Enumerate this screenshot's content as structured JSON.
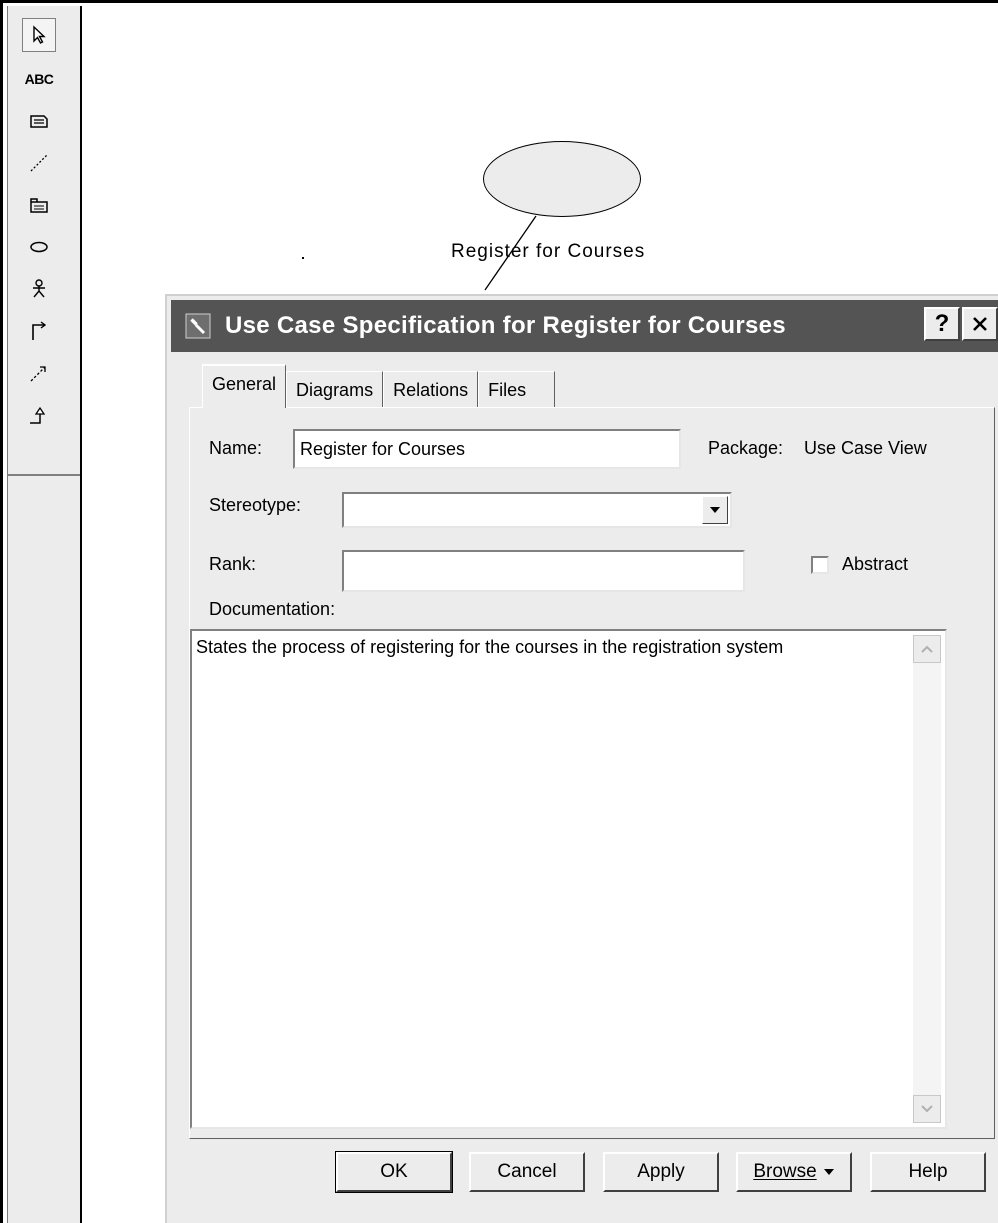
{
  "toolbox": {
    "tools": [
      {
        "name": "selection-arrow-icon"
      },
      {
        "name": "text-box-tool",
        "label": "ABC"
      },
      {
        "name": "note-icon"
      },
      {
        "name": "anchor-note-icon"
      },
      {
        "name": "package-icon"
      },
      {
        "name": "use-case-icon"
      },
      {
        "name": "actor-icon"
      },
      {
        "name": "unidirectional-association-icon"
      },
      {
        "name": "dependency-icon"
      },
      {
        "name": "generalization-icon"
      }
    ]
  },
  "canvas": {
    "use_case_label": "Register for Courses"
  },
  "dialog": {
    "title": "Use Case Specification for Register for Courses",
    "help_glyph": "?",
    "tabs": [
      {
        "label": "General",
        "active": true
      },
      {
        "label": "Diagrams",
        "active": false
      },
      {
        "label": "Relations",
        "active": false
      },
      {
        "label": "Files",
        "active": false
      }
    ],
    "name_label": "Name:",
    "name_value": "Register for Courses",
    "package_label": "Package:",
    "package_value": "Use Case View",
    "stereotype_label": "Stereotype:",
    "stereotype_value": "",
    "rank_label": "Rank:",
    "rank_value": "",
    "abstract_label": "Abstract",
    "abstract_checked": false,
    "documentation_label": "Documentation:",
    "documentation_text": "States the process of registering for the courses in the registration system",
    "buttons": {
      "ok": "OK",
      "cancel": "Cancel",
      "apply": "Apply",
      "browse": "Browse",
      "help": "Help"
    }
  }
}
